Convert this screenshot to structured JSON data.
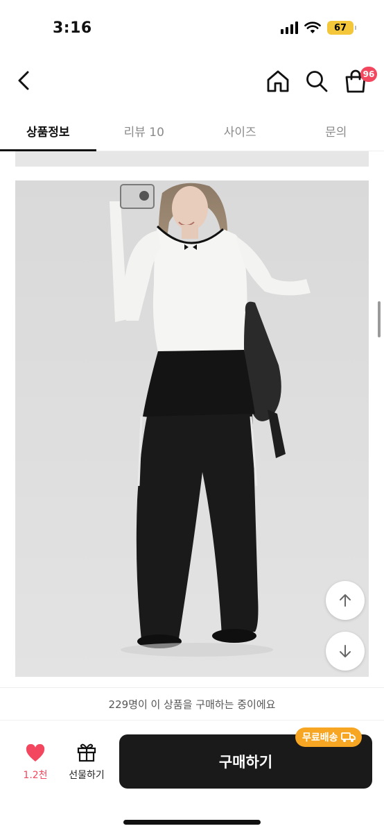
{
  "status_bar": {
    "time": "3:16",
    "battery": "67",
    "icons": [
      "cellular-signal-icon",
      "wifi-icon",
      "battery-icon"
    ]
  },
  "header": {
    "icons": [
      "back-arrow-icon",
      "home-icon",
      "search-icon",
      "shopping-bag-icon"
    ],
    "cart_badge": "96"
  },
  "tabs": [
    {
      "label": "상품정보",
      "active": true
    },
    {
      "label": "리뷰 10",
      "active": false
    },
    {
      "label": "사이즈",
      "active": false
    },
    {
      "label": "문의",
      "active": false
    }
  ],
  "floating_buttons": [
    "arrow-up-icon",
    "arrow-down-icon"
  ],
  "purchase_info": "229명이 이 상품을 구매하는 중이에요",
  "bottom_bar": {
    "like_count": "1.2천",
    "gift_label": "선물하기",
    "buy_label": "구매하기",
    "free_shipping_label": "무료배송"
  },
  "colors": {
    "accent": "#f2475f",
    "buy_button": "#1a1a1a",
    "shipping_badge": "#f6a623",
    "battery": "#f4c63a"
  }
}
